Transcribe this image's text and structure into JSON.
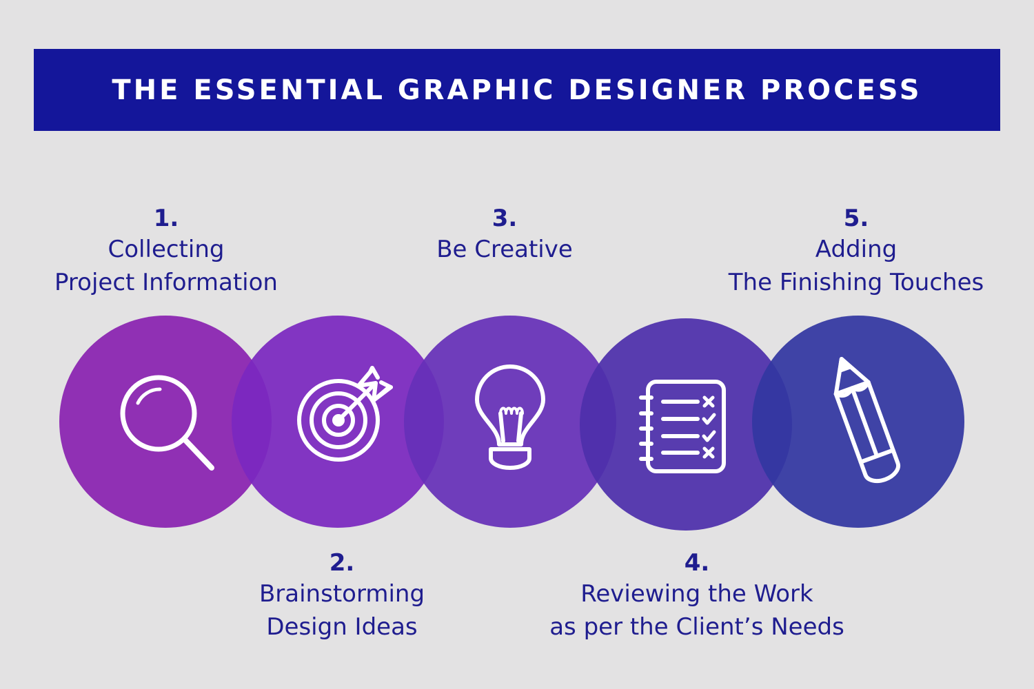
{
  "title": "THE ESSENTIAL GRAPHIC DESIGNER PROCESS",
  "colors": {
    "banner": "#14169a",
    "text": "#1f1d8f",
    "circles": [
      "#8a22b0",
      "#7b28bf",
      "#6630b8",
      "#4d2fab",
      "#3337a1"
    ]
  },
  "steps": [
    {
      "number": "1.",
      "lines": [
        "Collecting",
        "Project Information"
      ],
      "icon": "magnifier-icon"
    },
    {
      "number": "2.",
      "lines": [
        "Brainstorming",
        "Design Ideas"
      ],
      "icon": "target-icon"
    },
    {
      "number": "3.",
      "lines": [
        "Be Creative"
      ],
      "icon": "lightbulb-icon"
    },
    {
      "number": "4.",
      "lines": [
        "Reviewing the Work",
        "as per the Client’s Needs"
      ],
      "icon": "checklist-icon"
    },
    {
      "number": "5.",
      "lines": [
        "Adding",
        "The Finishing Touches"
      ],
      "icon": "pencil-icon"
    }
  ]
}
